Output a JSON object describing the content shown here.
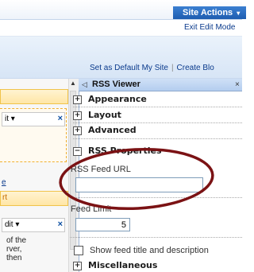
{
  "topbar": {
    "site_actions": "Site Actions",
    "site_actions_arrow": "▾",
    "exit_edit_mode": "Exit Edit Mode"
  },
  "links": {
    "default_site": "Set as Default My Site",
    "create_blog": "Create Blo",
    "separator": "|"
  },
  "left_zone": {
    "edit_label_1": "it ▾",
    "close_1": "×",
    "link_text": "e",
    "bar_text": "rt",
    "edit_label_2": "dit ▾",
    "close_2": "×",
    "text_lines": "of the\nrver,\nthen"
  },
  "pane": {
    "back_arrow": "◁",
    "title": "RSS Viewer",
    "close": "×",
    "sections": {
      "appearance": "Appearance",
      "layout": "Layout",
      "advanced": "Advanced",
      "rss_properties": "RSS Properties",
      "miscellaneous": "Miscellaneous"
    },
    "collapsed_symbol": "+",
    "expanded_symbol": "−",
    "rss_feed_url_label": "RSS Feed URL",
    "rss_feed_url_value": "",
    "feed_limit_label": "Feed Limit",
    "feed_limit_value": "5",
    "show_feed_title": "Show feed title and description",
    "show_feed_title_checked": false
  },
  "scroll_up_arrow": "▲",
  "colors": {
    "annotation": "#7b1214",
    "site_actions_bg": "#1d5db0",
    "link": "#0a3a8c"
  }
}
